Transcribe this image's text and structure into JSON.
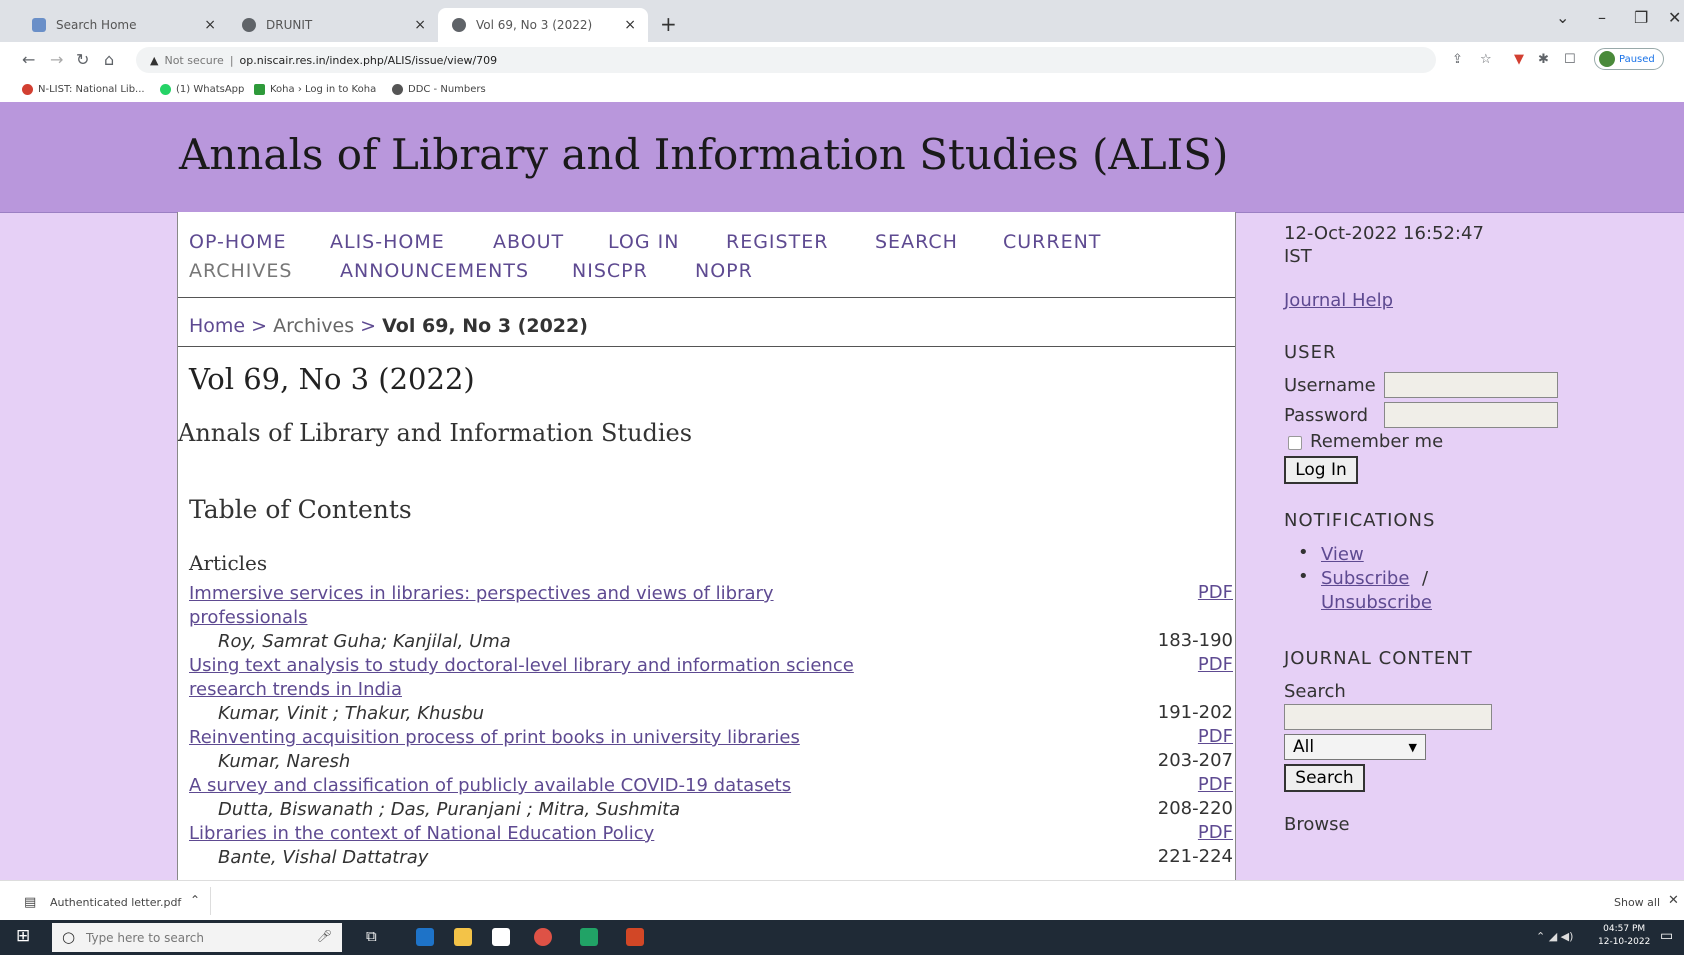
{
  "browser": {
    "tabs": [
      {
        "title": "Search Home",
        "active": false
      },
      {
        "title": "DRUNIT",
        "active": false
      },
      {
        "title": "Vol 69, No 3 (2022)",
        "active": true
      }
    ],
    "address": {
      "security": "Not secure",
      "url": "op.niscair.res.in/index.php/ALIS/issue/view/709"
    },
    "profile_label": "Paused",
    "bookmarks": [
      {
        "label": "N-LIST: National Lib...",
        "color": "#d23f31"
      },
      {
        "label": "(1) WhatsApp",
        "color": "#25d366"
      },
      {
        "label": "Koha › Log in to Koha",
        "color": "#2e9a3a"
      },
      {
        "label": "DDC - Numbers",
        "color": "#555555"
      }
    ]
  },
  "site": {
    "title": "Annals of Library and Information Studies (ALIS)",
    "nav": [
      "OP-HOME",
      "ALIS-HOME",
      "ABOUT",
      "LOG IN",
      "REGISTER",
      "SEARCH",
      "CURRENT",
      "ARCHIVES",
      "ANNOUNCEMENTS",
      "NISCPR",
      "NOPR"
    ],
    "breadcrumb": {
      "home": "Home",
      "sep": ">",
      "archives": "Archives",
      "current": "Vol 69, No 3 (2022)"
    }
  },
  "issue": {
    "title": "Vol 69, No 3 (2022)",
    "journal": "Annals of Library and Information Studies",
    "toc_heading": "Table of Contents",
    "section": "Articles",
    "pdf_label": "PDF",
    "articles": [
      {
        "title_line1": "Immersive services in libraries: perspectives and views of library",
        "title_line2": "professionals",
        "authors": "Roy, Samrat Guha; Kanjilal, Uma",
        "pages": "183-190"
      },
      {
        "title_line1": "Using text analysis to study doctoral-level library and information science",
        "title_line2": "research trends in India",
        "authors": "Kumar, Vinit ; Thakur, Khusbu",
        "pages": "191-202"
      },
      {
        "title_line1": "Reinventing acquisition process of print books in university libraries",
        "title_line2": "",
        "authors": "Kumar, Naresh",
        "pages": "203-207"
      },
      {
        "title_line1": "A survey and classification of publicly available COVID-19 datasets",
        "title_line2": "",
        "authors": "Dutta, Biswanath ; Das, Puranjani ; Mitra, Sushmita",
        "pages": "208-220"
      },
      {
        "title_line1": "Libraries in the context of National Education Policy",
        "title_line2": "",
        "authors": "Bante, Vishal Dattatray",
        "pages": "221-224"
      }
    ]
  },
  "sidebar": {
    "datetime_line1": "12-Oct-2022 16:52:47",
    "datetime_line2": "IST",
    "journal_help": "Journal Help",
    "user": {
      "heading": "USER",
      "username_label": "Username",
      "password_label": "Password",
      "remember": "Remember me",
      "login_button": "Log In"
    },
    "notifications": {
      "heading": "NOTIFICATIONS",
      "view": "View",
      "subscribe": "Subscribe",
      "slash": "/",
      "unsubscribe": "Unsubscribe"
    },
    "journal_content": {
      "heading": "JOURNAL CONTENT",
      "search_label": "Search",
      "scope_selected": "All",
      "search_button": "Search",
      "browse": "Browse"
    }
  },
  "download_bar": {
    "file": "Authenticated letter.pdf",
    "show_all": "Show all"
  },
  "taskbar": {
    "search_placeholder": "Type here to search",
    "time": "04:57 PM",
    "date": "12-10-2022"
  }
}
